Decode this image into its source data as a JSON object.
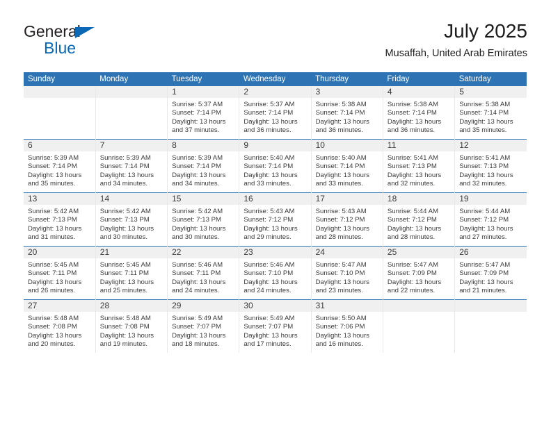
{
  "brand": {
    "name_part1": "General",
    "name_part2": "Blue",
    "triangle_color": "#0a68b4"
  },
  "header": {
    "title": "July 2025",
    "subtitle": "Musaffah, United Arab Emirates"
  },
  "theme": {
    "header_blue": "#2e74b5",
    "daynum_gray": "#f0f0f0",
    "text": "#3a3a3a"
  },
  "calendar": {
    "weekday_headers": [
      "Sunday",
      "Monday",
      "Tuesday",
      "Wednesday",
      "Thursday",
      "Friday",
      "Saturday"
    ],
    "weeks": [
      [
        {
          "day": "",
          "lines": [
            "",
            "",
            "",
            ""
          ],
          "empty": true
        },
        {
          "day": "",
          "lines": [
            "",
            "",
            "",
            ""
          ],
          "empty": true
        },
        {
          "day": "1",
          "lines": [
            "Sunrise: 5:37 AM",
            "Sunset: 7:14 PM",
            "Daylight: 13 hours",
            "and 37 minutes."
          ],
          "empty": false
        },
        {
          "day": "2",
          "lines": [
            "Sunrise: 5:37 AM",
            "Sunset: 7:14 PM",
            "Daylight: 13 hours",
            "and 36 minutes."
          ],
          "empty": false
        },
        {
          "day": "3",
          "lines": [
            "Sunrise: 5:38 AM",
            "Sunset: 7:14 PM",
            "Daylight: 13 hours",
            "and 36 minutes."
          ],
          "empty": false
        },
        {
          "day": "4",
          "lines": [
            "Sunrise: 5:38 AM",
            "Sunset: 7:14 PM",
            "Daylight: 13 hours",
            "and 36 minutes."
          ],
          "empty": false
        },
        {
          "day": "5",
          "lines": [
            "Sunrise: 5:38 AM",
            "Sunset: 7:14 PM",
            "Daylight: 13 hours",
            "and 35 minutes."
          ],
          "empty": false
        }
      ],
      [
        {
          "day": "6",
          "lines": [
            "Sunrise: 5:39 AM",
            "Sunset: 7:14 PM",
            "Daylight: 13 hours",
            "and 35 minutes."
          ],
          "empty": false
        },
        {
          "day": "7",
          "lines": [
            "Sunrise: 5:39 AM",
            "Sunset: 7:14 PM",
            "Daylight: 13 hours",
            "and 34 minutes."
          ],
          "empty": false
        },
        {
          "day": "8",
          "lines": [
            "Sunrise: 5:39 AM",
            "Sunset: 7:14 PM",
            "Daylight: 13 hours",
            "and 34 minutes."
          ],
          "empty": false
        },
        {
          "day": "9",
          "lines": [
            "Sunrise: 5:40 AM",
            "Sunset: 7:14 PM",
            "Daylight: 13 hours",
            "and 33 minutes."
          ],
          "empty": false
        },
        {
          "day": "10",
          "lines": [
            "Sunrise: 5:40 AM",
            "Sunset: 7:14 PM",
            "Daylight: 13 hours",
            "and 33 minutes."
          ],
          "empty": false
        },
        {
          "day": "11",
          "lines": [
            "Sunrise: 5:41 AM",
            "Sunset: 7:13 PM",
            "Daylight: 13 hours",
            "and 32 minutes."
          ],
          "empty": false
        },
        {
          "day": "12",
          "lines": [
            "Sunrise: 5:41 AM",
            "Sunset: 7:13 PM",
            "Daylight: 13 hours",
            "and 32 minutes."
          ],
          "empty": false
        }
      ],
      [
        {
          "day": "13",
          "lines": [
            "Sunrise: 5:42 AM",
            "Sunset: 7:13 PM",
            "Daylight: 13 hours",
            "and 31 minutes."
          ],
          "empty": false
        },
        {
          "day": "14",
          "lines": [
            "Sunrise: 5:42 AM",
            "Sunset: 7:13 PM",
            "Daylight: 13 hours",
            "and 30 minutes."
          ],
          "empty": false
        },
        {
          "day": "15",
          "lines": [
            "Sunrise: 5:42 AM",
            "Sunset: 7:13 PM",
            "Daylight: 13 hours",
            "and 30 minutes."
          ],
          "empty": false
        },
        {
          "day": "16",
          "lines": [
            "Sunrise: 5:43 AM",
            "Sunset: 7:12 PM",
            "Daylight: 13 hours",
            "and 29 minutes."
          ],
          "empty": false
        },
        {
          "day": "17",
          "lines": [
            "Sunrise: 5:43 AM",
            "Sunset: 7:12 PM",
            "Daylight: 13 hours",
            "and 28 minutes."
          ],
          "empty": false
        },
        {
          "day": "18",
          "lines": [
            "Sunrise: 5:44 AM",
            "Sunset: 7:12 PM",
            "Daylight: 13 hours",
            "and 28 minutes."
          ],
          "empty": false
        },
        {
          "day": "19",
          "lines": [
            "Sunrise: 5:44 AM",
            "Sunset: 7:12 PM",
            "Daylight: 13 hours",
            "and 27 minutes."
          ],
          "empty": false
        }
      ],
      [
        {
          "day": "20",
          "lines": [
            "Sunrise: 5:45 AM",
            "Sunset: 7:11 PM",
            "Daylight: 13 hours",
            "and 26 minutes."
          ],
          "empty": false
        },
        {
          "day": "21",
          "lines": [
            "Sunrise: 5:45 AM",
            "Sunset: 7:11 PM",
            "Daylight: 13 hours",
            "and 25 minutes."
          ],
          "empty": false
        },
        {
          "day": "22",
          "lines": [
            "Sunrise: 5:46 AM",
            "Sunset: 7:11 PM",
            "Daylight: 13 hours",
            "and 24 minutes."
          ],
          "empty": false
        },
        {
          "day": "23",
          "lines": [
            "Sunrise: 5:46 AM",
            "Sunset: 7:10 PM",
            "Daylight: 13 hours",
            "and 24 minutes."
          ],
          "empty": false
        },
        {
          "day": "24",
          "lines": [
            "Sunrise: 5:47 AM",
            "Sunset: 7:10 PM",
            "Daylight: 13 hours",
            "and 23 minutes."
          ],
          "empty": false
        },
        {
          "day": "25",
          "lines": [
            "Sunrise: 5:47 AM",
            "Sunset: 7:09 PM",
            "Daylight: 13 hours",
            "and 22 minutes."
          ],
          "empty": false
        },
        {
          "day": "26",
          "lines": [
            "Sunrise: 5:47 AM",
            "Sunset: 7:09 PM",
            "Daylight: 13 hours",
            "and 21 minutes."
          ],
          "empty": false
        }
      ],
      [
        {
          "day": "27",
          "lines": [
            "Sunrise: 5:48 AM",
            "Sunset: 7:08 PM",
            "Daylight: 13 hours",
            "and 20 minutes."
          ],
          "empty": false
        },
        {
          "day": "28",
          "lines": [
            "Sunrise: 5:48 AM",
            "Sunset: 7:08 PM",
            "Daylight: 13 hours",
            "and 19 minutes."
          ],
          "empty": false
        },
        {
          "day": "29",
          "lines": [
            "Sunrise: 5:49 AM",
            "Sunset: 7:07 PM",
            "Daylight: 13 hours",
            "and 18 minutes."
          ],
          "empty": false
        },
        {
          "day": "30",
          "lines": [
            "Sunrise: 5:49 AM",
            "Sunset: 7:07 PM",
            "Daylight: 13 hours",
            "and 17 minutes."
          ],
          "empty": false
        },
        {
          "day": "31",
          "lines": [
            "Sunrise: 5:50 AM",
            "Sunset: 7:06 PM",
            "Daylight: 13 hours",
            "and 16 minutes."
          ],
          "empty": false
        },
        {
          "day": "",
          "lines": [
            "",
            "",
            "",
            ""
          ],
          "empty": true
        },
        {
          "day": "",
          "lines": [
            "",
            "",
            "",
            ""
          ],
          "empty": true
        }
      ]
    ]
  }
}
